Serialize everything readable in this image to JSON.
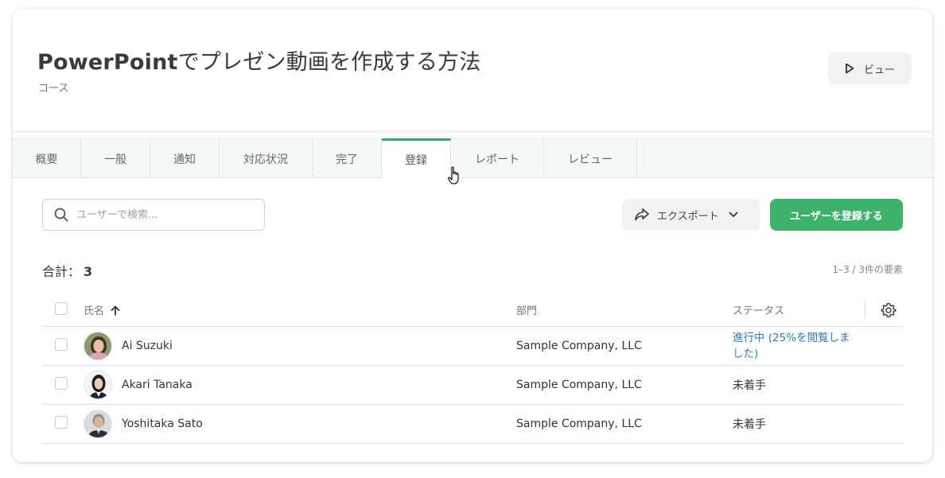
{
  "header": {
    "title_bold": "PowerPoint",
    "title_rest": "でプレゼン動画を作成する方法",
    "subtitle": "コース",
    "view_button": "ビュー"
  },
  "tabs": [
    {
      "label": "概要",
      "active": false
    },
    {
      "label": "一般",
      "active": false
    },
    {
      "label": "通知",
      "active": false
    },
    {
      "label": "対応状況",
      "active": false
    },
    {
      "label": "完了",
      "active": false
    },
    {
      "label": "登録",
      "active": true
    },
    {
      "label": "レポート",
      "active": false
    },
    {
      "label": "レビュー",
      "active": false
    }
  ],
  "toolbar": {
    "search_placeholder": "ユーザーで検索...",
    "export_label": "エクスポート",
    "register_label": "ユーザーを登録する"
  },
  "summary": {
    "total_label": "合計：",
    "total_value": "3",
    "range_text": "1–3 / 3件の要素"
  },
  "table": {
    "columns": {
      "name": "氏名",
      "department": "部門",
      "status": "ステータス"
    },
    "rows": [
      {
        "name": "Ai Suzuki",
        "department": "Sample Company, LLC",
        "status": "進行中 (25%を閲覧しました)",
        "status_is_link": true
      },
      {
        "name": "Akari Tanaka",
        "department": "Sample Company, LLC",
        "status": "未着手",
        "status_is_link": false
      },
      {
        "name": "Yoshitaka Sato",
        "department": "Sample Company, LLC",
        "status": "未着手",
        "status_is_link": false
      }
    ]
  },
  "colors": {
    "accent_green": "#3cb26a",
    "link_blue": "#2f7fb8",
    "tab_bg": "#f4f8f9"
  }
}
